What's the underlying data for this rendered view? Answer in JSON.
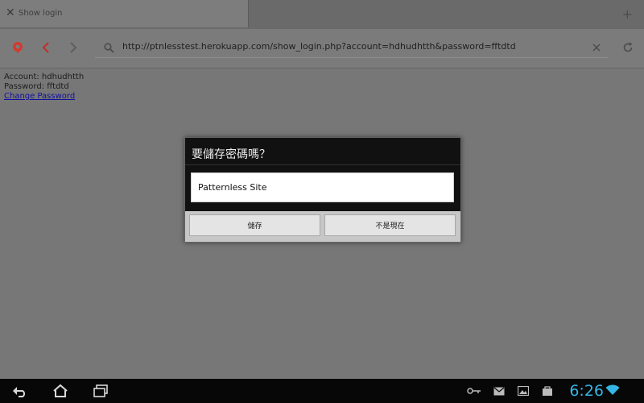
{
  "tab": {
    "title": "Show login"
  },
  "toolbar": {
    "url": "http://ptnlesstest.herokuapp.com/show_login.php?account=hdhudhtth&password=fftdtd"
  },
  "page": {
    "account_line": "Account: hdhudhtth",
    "password_line": "Password: fftdtd",
    "change_password_link": "Change Password"
  },
  "dialog": {
    "title": "要儲存密碼嗎？",
    "site": "Patternless Site",
    "save_label": "儲存",
    "not_now_label": "不是現在"
  },
  "statusbar": {
    "time": "6:26"
  },
  "colors": {
    "clock": "#35b5e5",
    "accent_red": "#d23b2d",
    "link": "#1010a0"
  },
  "icons": [
    "close-icon",
    "new-tab-icon",
    "app-logo-icon",
    "back-arrow-icon",
    "forward-arrow-icon",
    "search-icon",
    "clear-icon",
    "reload-icon",
    "nav-back-icon",
    "home-icon",
    "recent-apps-icon",
    "key-icon",
    "email-icon",
    "gallery-icon",
    "store-icon",
    "wifi-icon"
  ]
}
